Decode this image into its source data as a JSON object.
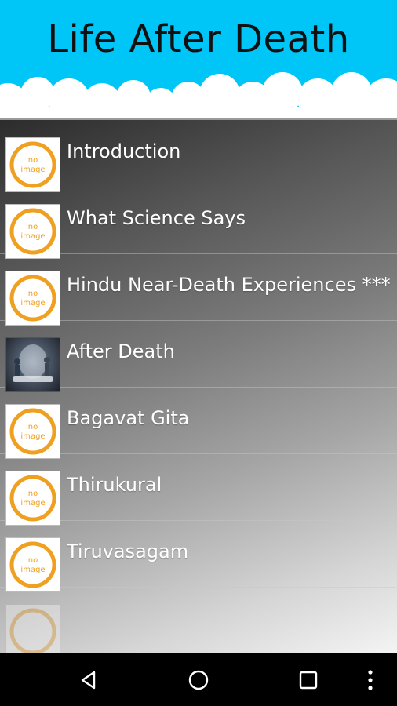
{
  "header": {
    "title": "Life After Death"
  },
  "list": {
    "items": [
      {
        "label": "Introduction",
        "thumbnail": "no-image"
      },
      {
        "label": "What Science Says",
        "thumbnail": "no-image"
      },
      {
        "label": "Hindu Near-Death Experiences ***",
        "thumbnail": "no-image"
      },
      {
        "label": "After Death",
        "thumbnail": "photo"
      },
      {
        "label": "Bagavat Gita",
        "thumbnail": "no-image"
      },
      {
        "label": "Thirukural",
        "thumbnail": "no-image"
      },
      {
        "label": "Tiruvasagam",
        "thumbnail": "no-image"
      }
    ],
    "placeholder_text": {
      "line1": "no",
      "line2": "image"
    }
  },
  "navbar": {
    "buttons": [
      "back-icon",
      "home-icon",
      "recents-icon",
      "menu-icon"
    ]
  },
  "colors": {
    "header_bg": "#00c6f7",
    "placeholder_ring": "#f0a020",
    "navbar_bg": "#000000"
  }
}
